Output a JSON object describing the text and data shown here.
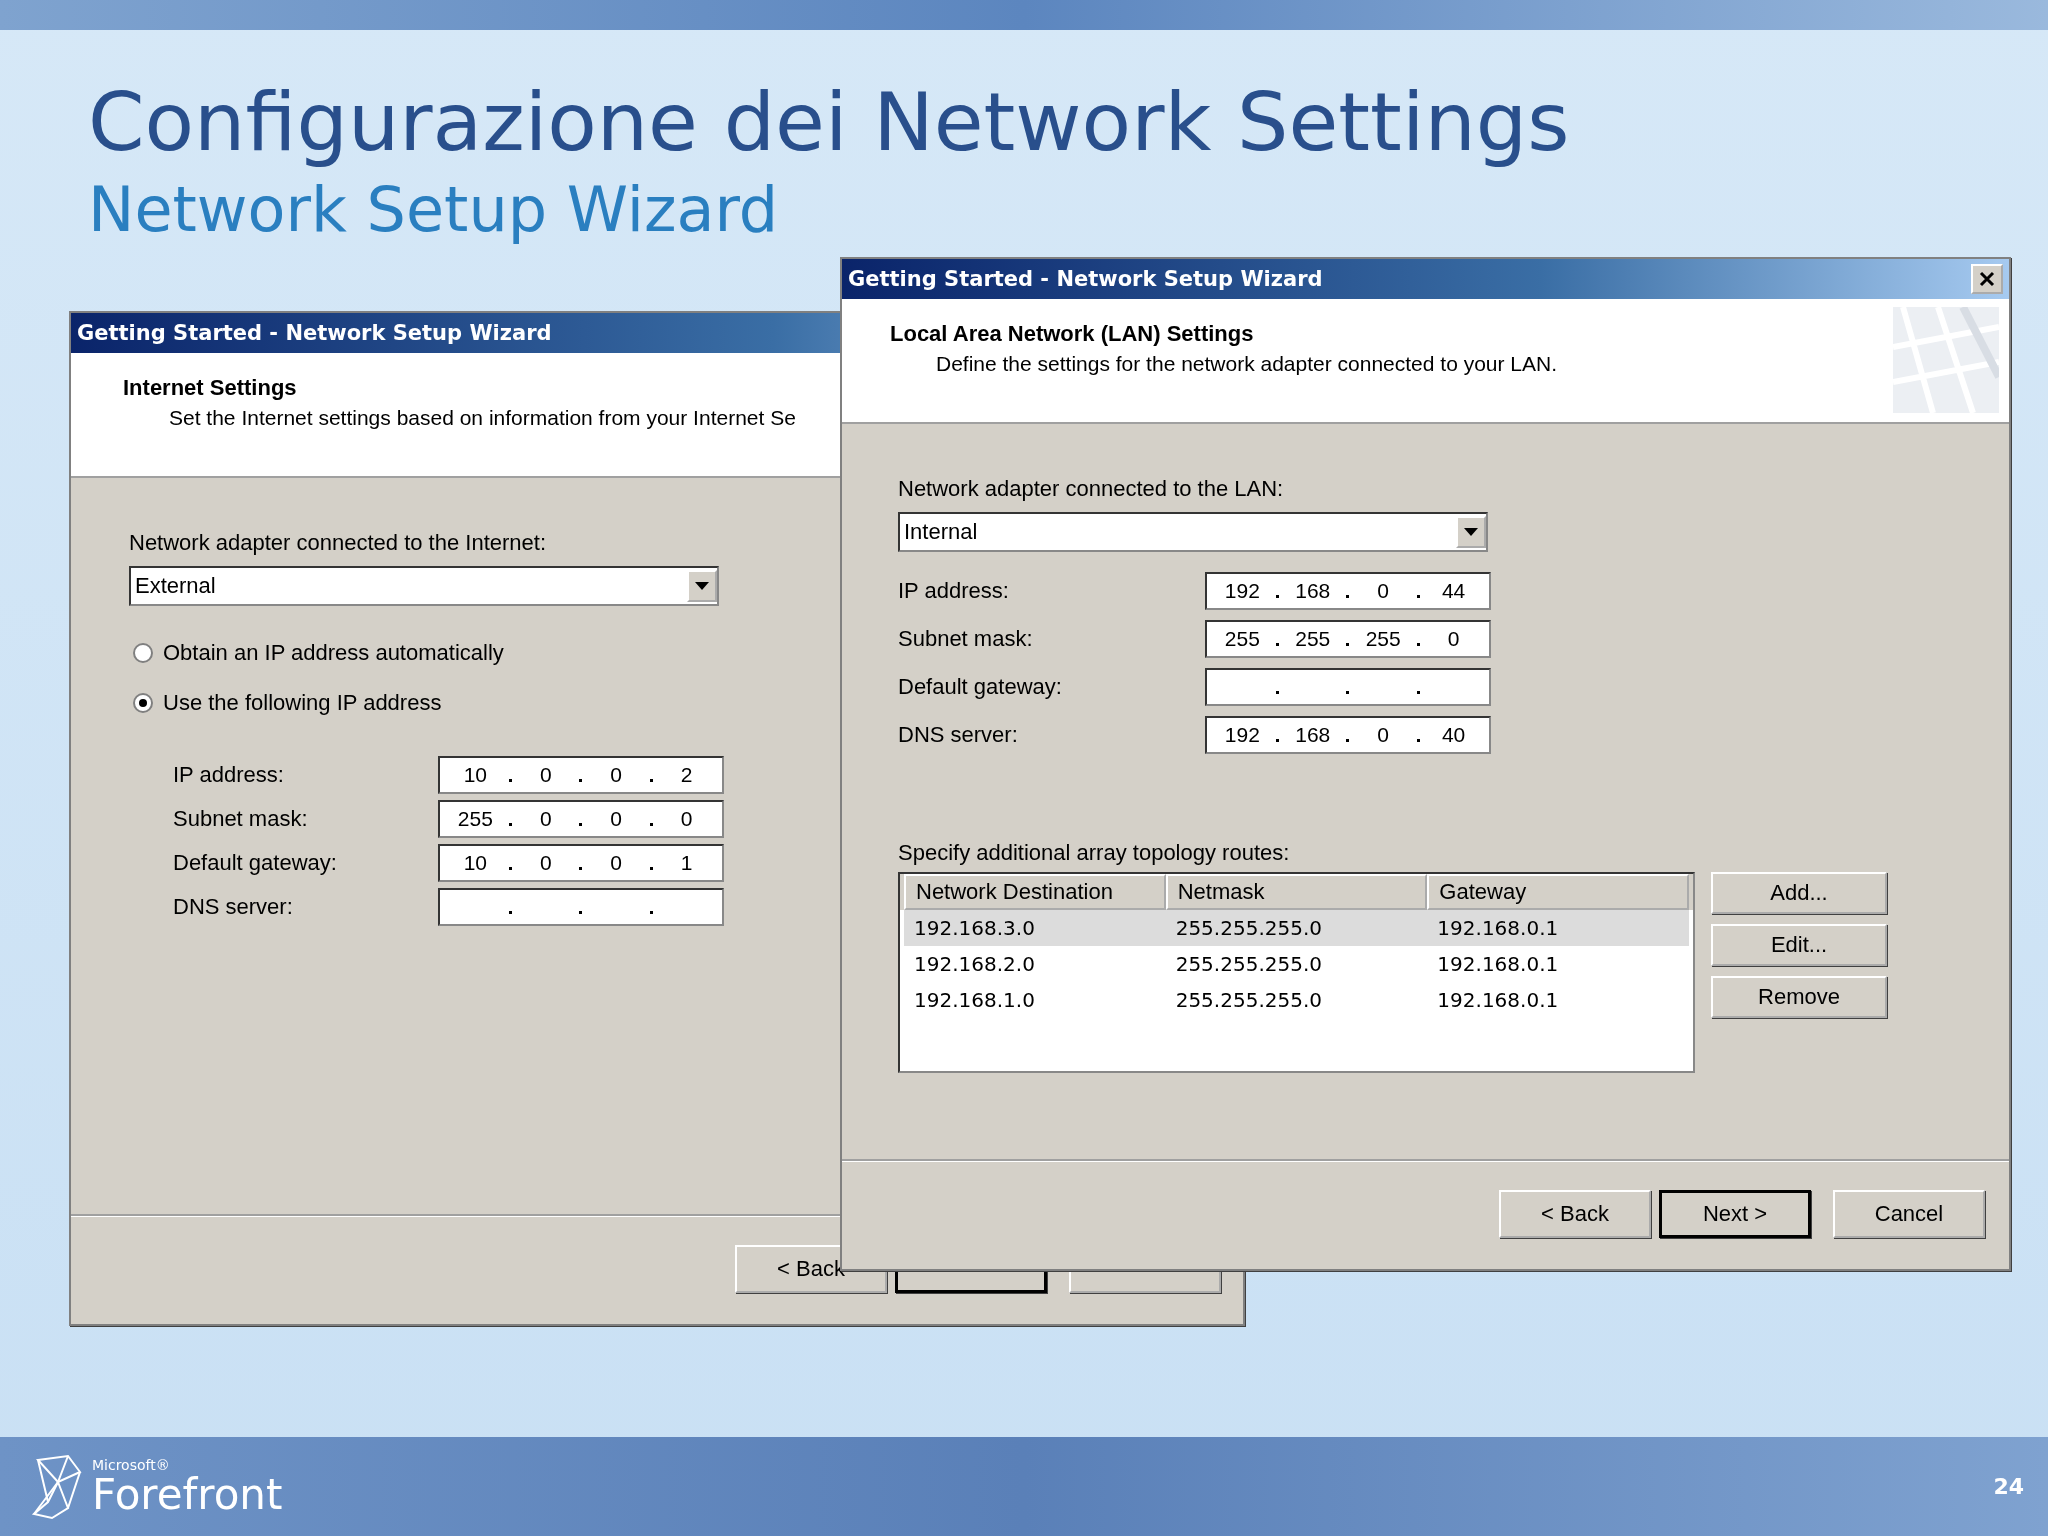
{
  "slide": {
    "title": "Configurazione dei Network Settings",
    "subtitle": "Network Setup Wizard"
  },
  "dialogs": [
    {
      "title": "Getting Started - Network Setup Wizard",
      "heading": "Internet Settings",
      "description": "Set the Internet settings based on information from your Internet Se",
      "adapter_label": "Network adapter connected to the Internet:",
      "adapter": "External",
      "radios": [
        {
          "label": "Obtain an IP address automatically",
          "selected": false
        },
        {
          "label": "Use the following IP address",
          "selected": true
        }
      ],
      "fields": [
        {
          "label": "IP address:",
          "octets": [
            "10",
            "0",
            "0",
            "2"
          ]
        },
        {
          "label": "Subnet mask:",
          "octets": [
            "255",
            "0",
            "0",
            "0"
          ]
        },
        {
          "label": "Default gateway:",
          "octets": [
            "10",
            "0",
            "0",
            "1"
          ]
        },
        {
          "label": "DNS server:"
        }
      ],
      "buttons": [
        {
          "label": "< Back",
          "default": false
        },
        {
          "default": true
        },
        {
          "default": false
        }
      ]
    },
    {
      "title": "Getting Started - Network Setup Wizard",
      "close_button": true,
      "heading": "Local Area Network (LAN) Settings",
      "description": "Define the settings for the network adapter connected to your LAN.",
      "adapter_label": "Network adapter connected to the LAN:",
      "adapter": "Internal",
      "fields": [
        {
          "label": "IP address:",
          "octets": [
            "192",
            "168",
            "0",
            "44"
          ]
        },
        {
          "label": "Subnet mask:",
          "octets": [
            "255",
            "255",
            "255",
            "0"
          ]
        },
        {
          "label": "Default gateway:"
        },
        {
          "label": "DNS server:",
          "octets": [
            "192",
            "168",
            "0",
            "40"
          ]
        }
      ],
      "routes_label": "Specify additional array topology routes:",
      "routes": {
        "columns": [
          "Network Destination",
          "Netmask",
          "Gateway"
        ],
        "rows": [
          {
            "cells": [
              "192.168.3.0",
              "255.255.255.0",
              "192.168.0.1"
            ],
            "selected": true
          },
          {
            "cells": [
              "192.168.2.0",
              "255.255.255.0",
              "192.168.0.1"
            ],
            "selected": false
          },
          {
            "cells": [
              "192.168.1.0",
              "255.255.255.0",
              "192.168.0.1"
            ],
            "selected": false
          }
        ]
      },
      "side_buttons": [
        "Add...",
        "Edit...",
        "Remove"
      ],
      "buttons": [
        {
          "label": "< Back",
          "default": false
        },
        {
          "label": "Next >",
          "default": true
        },
        {
          "label": "Cancel",
          "default": false
        }
      ]
    }
  ],
  "footer": {
    "brand_small": "Microsoft®",
    "brand": "Forefront",
    "page": "24"
  }
}
